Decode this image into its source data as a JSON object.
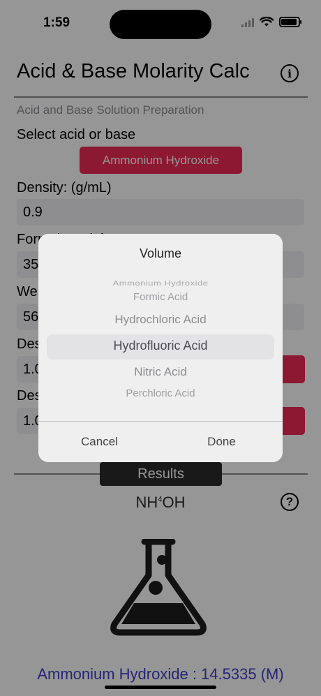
{
  "status_bar": {
    "time": "1:59",
    "battery_level": 0.9
  },
  "header": {
    "title": "Acid & Base Molarity Calc",
    "info_icon": "info-icon"
  },
  "form": {
    "subtitle": "Acid and Base Solution Preparation",
    "select_label": "Select acid or base",
    "selected_chemical": "Ammonium Hydroxide",
    "density_label": "Density:  (g/mL)",
    "density_value": "0.9",
    "formula_weight_label": "Formula weight",
    "formula_weight_value": "35",
    "weight_label": "We",
    "weight_value": "56",
    "desired_1_label": "Des",
    "desired_1_value": "1.0",
    "desired_2_label": "Des",
    "desired_2_value": "1.0",
    "accent_color": "#ef2955"
  },
  "results": {
    "bar_label": "Results",
    "formula_main": "NH",
    "formula_sub": "4",
    "formula_end": "OH",
    "help_icon": "help-icon",
    "flask_icon": "flask-icon",
    "result_text": "Ammonium Hydroxide : 14.5335 (M)",
    "result_color": "#3e3fc7"
  },
  "picker_dialog": {
    "title": "Volume",
    "options": [
      "Ammonium Hydroxide",
      "Formic Acid",
      "Hydrochloric Acid",
      "Hydrofluoric Acid",
      "Nitric Acid",
      "Perchloric Acid"
    ],
    "selected": "Hydrofluoric Acid",
    "cancel_label": "Cancel",
    "done_label": "Done"
  }
}
